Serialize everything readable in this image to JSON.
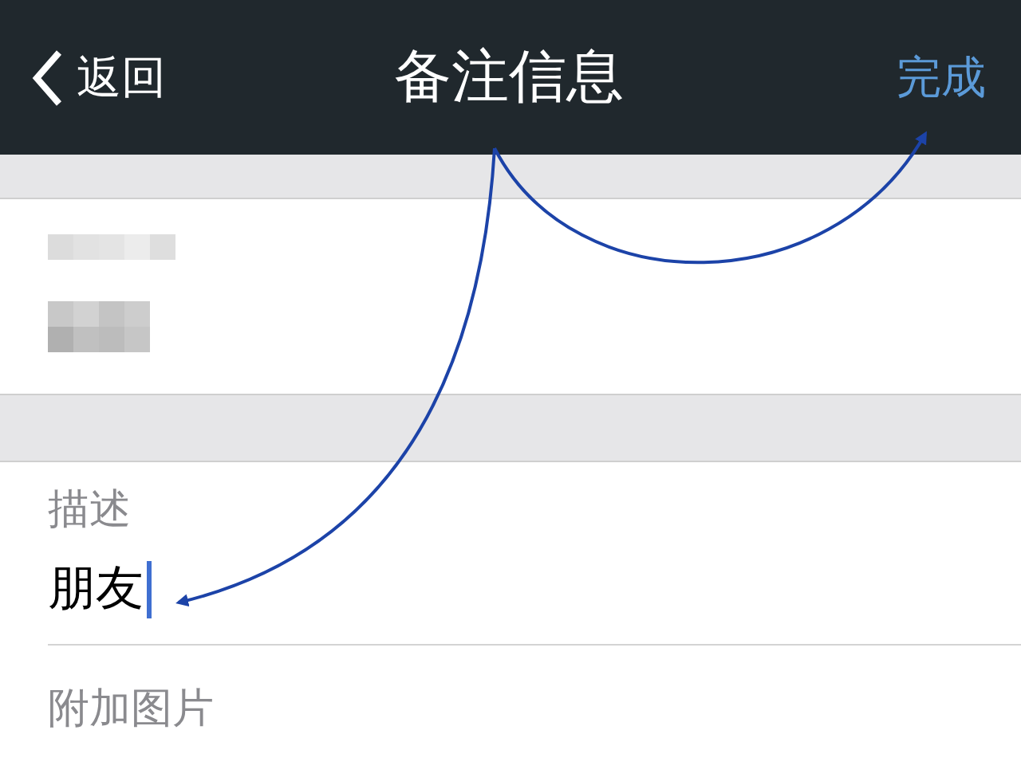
{
  "nav_bar": {
    "back": "返回",
    "title": "备注信息",
    "action": "完成"
  },
  "remark_name": {
    "redacted": true
  },
  "description": {
    "label": "描述",
    "value": "朋友"
  },
  "attach_image": {
    "label": "附加图片"
  }
}
